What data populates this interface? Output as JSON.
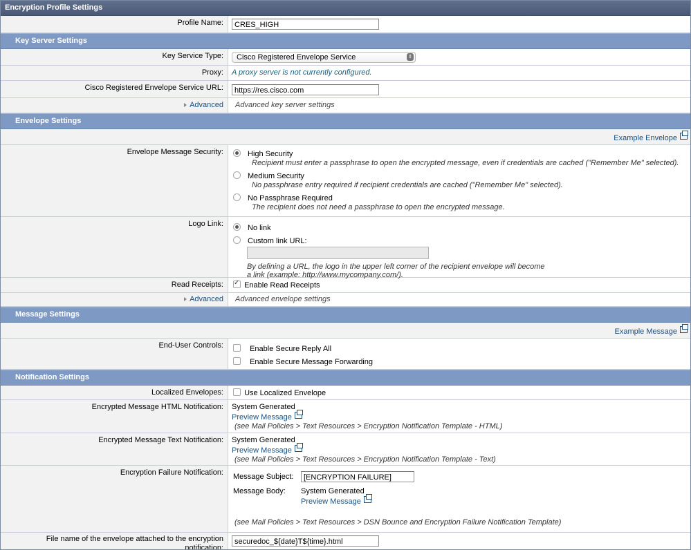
{
  "title": "Encryption Profile Settings",
  "profile": {
    "label": "Profile Name:",
    "value": "CRES_HIGH"
  },
  "key_server": {
    "section": "Key Server Settings",
    "service_type_label": "Key Service Type:",
    "service_type_value": "Cisco Registered Envelope Service",
    "proxy_label": "Proxy:",
    "proxy_value": "A proxy server is not currently configured.",
    "url_label": "Cisco Registered Envelope Service URL:",
    "url_value": "https://res.cisco.com",
    "advanced_label": "Advanced",
    "advanced_desc": "Advanced key server settings"
  },
  "envelope": {
    "section": "Envelope Settings",
    "example_link": "Example Envelope",
    "security_label": "Envelope Message Security:",
    "options": [
      {
        "name": "High Security",
        "desc": "Recipient must enter a passphrase to open the encrypted message, even if credentials are cached (\"Remember Me\" selected)."
      },
      {
        "name": "Medium Security",
        "desc": "No passphrase entry required if recipient credentials are cached (\"Remember Me\" selected)."
      },
      {
        "name": "No Passphrase Required",
        "desc": "The recipient does not need a passphrase to open the encrypted message."
      }
    ],
    "logo_label": "Logo Link:",
    "logo_no_link": "No link",
    "logo_custom": "Custom link URL:",
    "logo_custom_value": "",
    "logo_help_1": "By defining a URL, the logo in the upper left corner of the recipient envelope will become",
    "logo_help_2": "a link (example: http://www.mycompany.com/).",
    "read_receipts_label": "Read Receipts:",
    "read_receipts_value": "Enable Read Receipts",
    "advanced_label": "Advanced",
    "advanced_desc": "Advanced envelope settings"
  },
  "message": {
    "section": "Message Settings",
    "example_link": "Example Message",
    "controls_label": "End-User Controls:",
    "reply_all": "Enable Secure Reply All",
    "forwarding": "Enable Secure Message Forwarding"
  },
  "notification": {
    "section": "Notification Settings",
    "localized_label": "Localized Envelopes:",
    "localized_value": "Use Localized Envelope",
    "html_label": "Encrypted Message HTML Notification:",
    "html_value": "System Generated",
    "html_preview": "Preview Message",
    "html_note": "(see Mail Policies > Text Resources > Encryption Notification Template - HTML)",
    "text_label": "Encrypted Message Text Notification:",
    "text_value": "System Generated",
    "text_preview": "Preview Message",
    "text_note": "(see Mail Policies > Text Resources > Encryption Notification Template - Text)",
    "failure_label": "Encryption Failure Notification:",
    "subject_label": "Message Subject:",
    "subject_value": "[ENCRYPTION FAILURE]",
    "body_label": "Message Body:",
    "body_value": "System Generated",
    "body_preview": "Preview Message",
    "failure_note": "(see Mail Policies > Text Resources > DSN Bounce and Encryption Failure Notification Template)",
    "filename_label_1": "File name of the envelope attached to the encryption",
    "filename_label_2": "notification:",
    "filename_value": "securedoc_${date}T${time}.html"
  }
}
